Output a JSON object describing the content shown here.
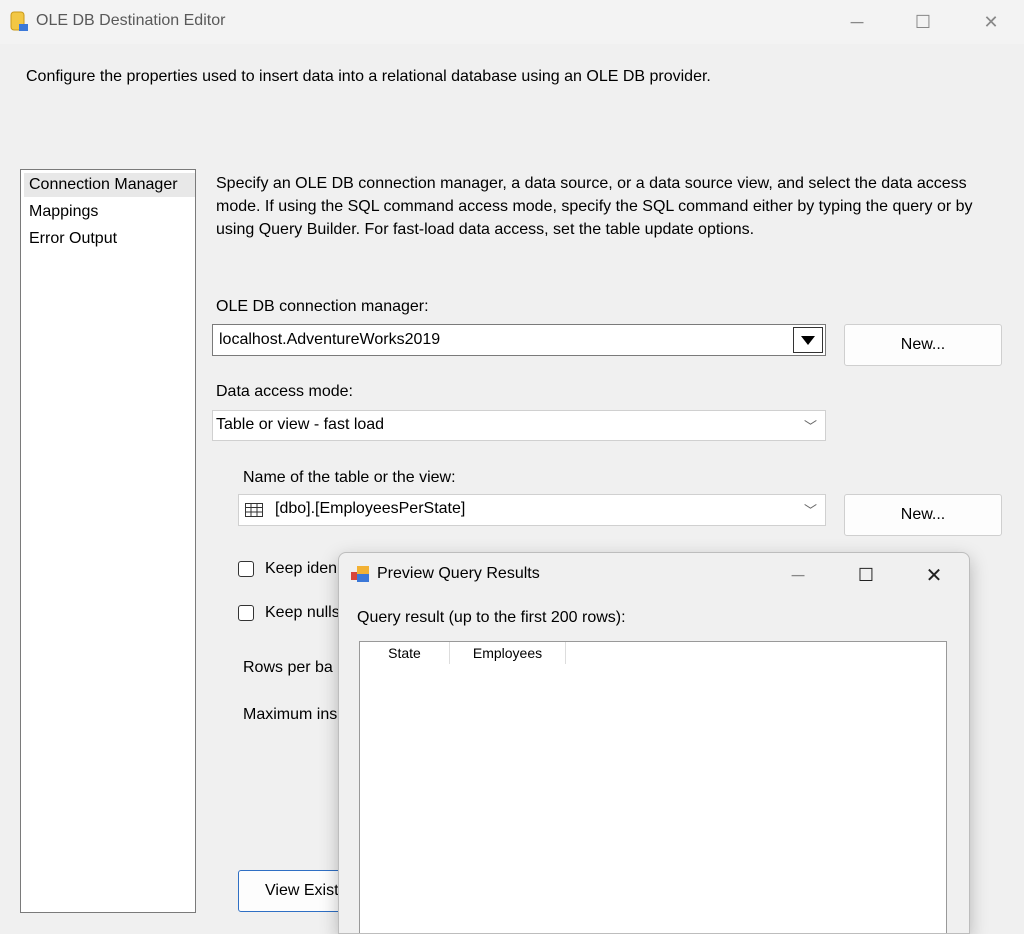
{
  "window": {
    "title": "OLE DB Destination Editor"
  },
  "description": "Configure the properties used to insert data into a relational database using an OLE DB provider.",
  "sidebar": {
    "items": [
      {
        "label": "Connection Manager"
      },
      {
        "label": "Mappings"
      },
      {
        "label": "Error Output"
      }
    ]
  },
  "main": {
    "intro": "Specify an OLE DB connection manager, a data source, or a data source view, and select the data access mode. If using the SQL command access mode, specify the SQL command either by typing the query or by using Query Builder. For fast-load data access, set the table update options.",
    "connection_label": "OLE DB connection manager:",
    "connection_value": "localhost.AdventureWorks2019",
    "new_button": "New...",
    "access_mode_label": "Data access mode:",
    "access_mode_value": "Table or view - fast load",
    "table_label": "Name of the table or the view:",
    "table_value": "[dbo].[EmployeesPerState]",
    "table_new_button": "New...",
    "keep_identity_label": "Keep iden",
    "keep_nulls_label": "Keep nulls",
    "rows_per_batch_label": "Rows per ba",
    "max_insert_label": "Maximum ins",
    "view_existing_button": "View Exist"
  },
  "dialog": {
    "title": "Preview Query Results",
    "result_label": "Query result (up to the first 200 rows):",
    "columns": [
      "State",
      "Employees"
    ]
  }
}
